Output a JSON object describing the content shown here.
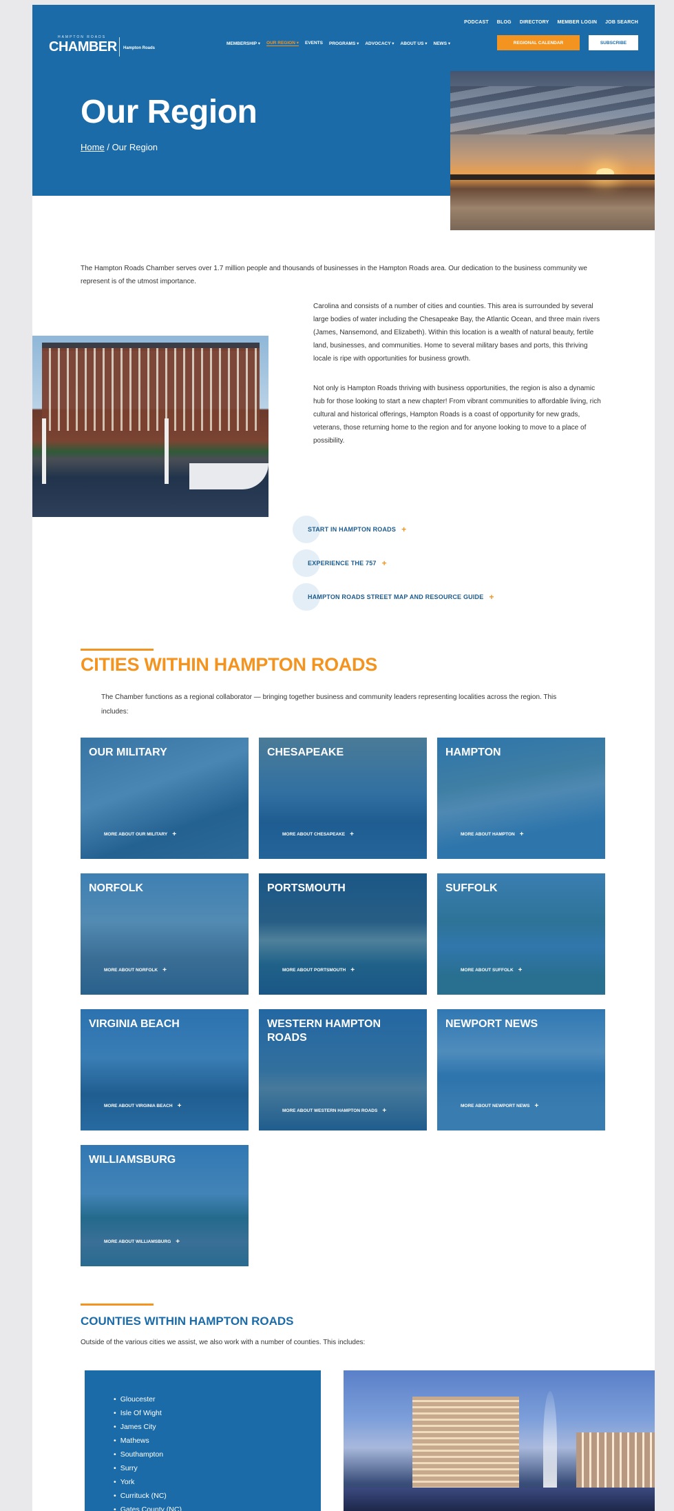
{
  "header": {
    "logo_top": "HAMPTON ROADS",
    "logo_main": "CHAMBER",
    "logo_sub": "Hampton Roads",
    "top_links": [
      "PODCAST",
      "BLOG",
      "DIRECTORY",
      "MEMBER LOGIN",
      "JOB SEARCH"
    ],
    "main_nav": [
      {
        "label": "MEMBERSHIP ▾",
        "active": false
      },
      {
        "label": "OUR REGION ▾",
        "active": true
      },
      {
        "label": "EVENTS",
        "active": false
      },
      {
        "label": "PROGRAMS ▾",
        "active": false
      },
      {
        "label": "ADVOCACY ▾",
        "active": false
      },
      {
        "label": "ABOUT US ▾",
        "active": false
      },
      {
        "label": "NEWS ▾",
        "active": false
      }
    ],
    "cta_orange": "REGIONAL CALENDAR",
    "cta_white": "SUBSCRIBE"
  },
  "hero": {
    "title": "Our Region",
    "breadcrumb_home": "Home",
    "breadcrumb_sep": "/",
    "breadcrumb_current": "Our Region"
  },
  "intro": {
    "text": "The Hampton Roads Chamber serves over 1.7 million people and thousands of businesses in the Hampton Roads area. Our dedication to the business community we represent is of the utmost importance."
  },
  "about": {
    "para1": "Carolina and consists of a number of cities and counties. This area is surrounded by several large bodies of water including the Chesapeake Bay, the Atlantic Ocean, and three main rivers (James, Nansemond, and Elizabeth). Within this location is a wealth of natural beauty, fertile land, businesses, and communities. Home to several military bases and ports, this thriving locale is ripe with opportunities for business growth.",
    "para2": "Not only is Hampton Roads thriving with business opportunities, the region is also a dynamic hub for those looking to start a new chapter! From vibrant communities to affordable living, rich cultural and historical offerings, Hampton Roads is a coast of opportunity for new grads, veterans, those returning home to the region and for anyone looking to move to a place of possibility."
  },
  "links": [
    {
      "label": "START IN HAMPTON ROADS",
      "icon": "+"
    },
    {
      "label": "EXPERIENCE THE 757",
      "icon": "+"
    },
    {
      "label": "HAMPTON ROADS STREET MAP AND RESOURCE GUIDE",
      "icon": "+"
    }
  ],
  "cities": {
    "title": "CITIES WITHIN HAMPTON ROADS",
    "intro": "The Chamber functions as a regional collaborator — bringing together business and community leaders representing localities across the region. This includes:",
    "items": [
      {
        "name": "OUR MILITARY",
        "more": "MORE ABOUT OUR MILITARY"
      },
      {
        "name": "CHESAPEAKE",
        "more": "MORE ABOUT CHESAPEAKE"
      },
      {
        "name": "HAMPTON",
        "more": "MORE ABOUT HAMPTON"
      },
      {
        "name": "NORFOLK",
        "more": "MORE ABOUT NORFOLK"
      },
      {
        "name": "PORTSMOUTH",
        "more": "MORE ABOUT PORTSMOUTH"
      },
      {
        "name": "SUFFOLK",
        "more": "MORE ABOUT SUFFOLK"
      },
      {
        "name": "VIRGINIA BEACH",
        "more": "MORE ABOUT VIRGINIA BEACH"
      },
      {
        "name": "WESTERN HAMPTON ROADS",
        "more": "MORE ABOUT WESTERN HAMPTON ROADS"
      },
      {
        "name": "NEWPORT NEWS",
        "more": "MORE ABOUT NEWPORT NEWS"
      },
      {
        "name": "WILLIAMSBURG",
        "more": "MORE ABOUT WILLIAMSBURG"
      }
    ]
  },
  "counties": {
    "title": "COUNTIES WITHIN HAMPTON ROADS",
    "intro": "Outside of the various cities we assist, we also work with a number of counties. This includes:",
    "items": [
      "Gloucester",
      "Isle Of Wight",
      "James City",
      "Mathews",
      "Southampton",
      "Surry",
      "York",
      "Currituck (NC)",
      "Gates County (NC)"
    ]
  },
  "colors": {
    "brand_blue": "#1b6ba8",
    "accent_orange": "#f39420"
  }
}
